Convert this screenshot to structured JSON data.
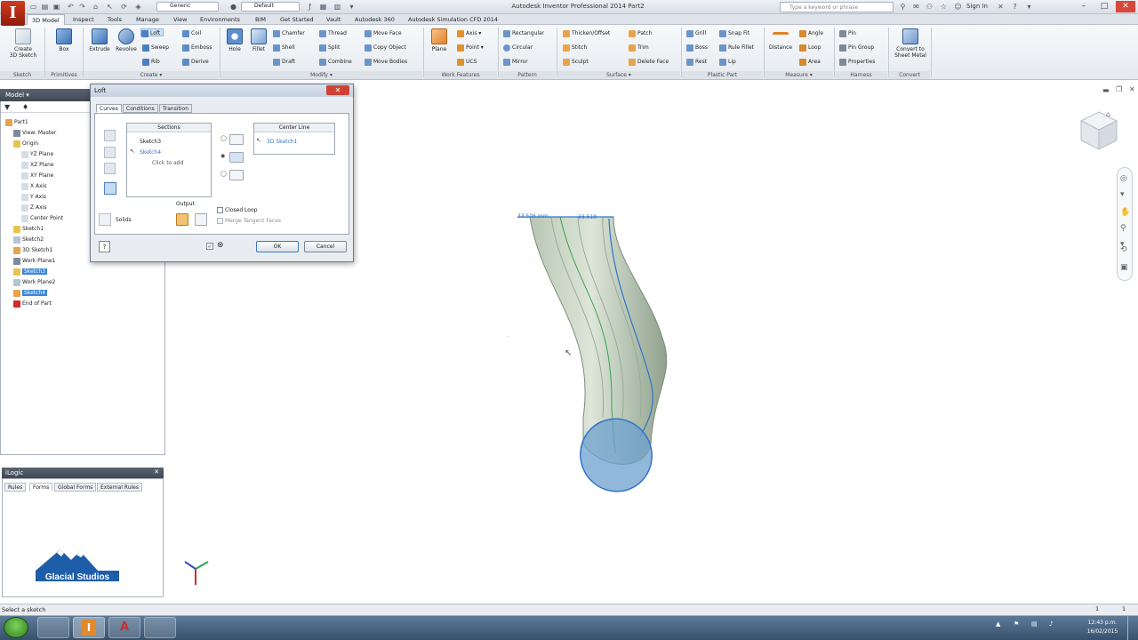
{
  "window": {
    "title": "Autodesk Inventor Professional 2014    Part2",
    "app_logo": "I",
    "qat_appearance": "Generic",
    "qat_style": "Default",
    "search_placeholder": "Type a keyword or phrase",
    "sign_in": "Sign In"
  },
  "ribbon_tabs": [
    "3D Model",
    "Inspect",
    "Tools",
    "Manage",
    "View",
    "Environments",
    "BIM",
    "Get Started",
    "Vault",
    "Autodesk 360",
    "Autodesk Simulation CFD 2014"
  ],
  "ribbon": {
    "sketch": {
      "label": "Sketch",
      "create_3d": "Create\n3D Sketch"
    },
    "primitives": {
      "label": "Primitives",
      "box": "Box"
    },
    "create": {
      "label": "Create ▾",
      "extrude": "Extrude",
      "revolve": "Revolve",
      "loft": "Loft",
      "sweep": "Sweep",
      "rib": "Rib",
      "coil": "Coil",
      "emboss": "Emboss",
      "derive": "Derive"
    },
    "modify": {
      "label": "Modify ▾",
      "hole": "Hole",
      "fillet": "Fillet",
      "chamfer": "Chamfer",
      "shell": "Shell",
      "draft": "Draft",
      "thread": "Thread",
      "split": "Split",
      "combine": "Combine",
      "move_face": "Move Face",
      "copy_object": "Copy Object",
      "move_bodies": "Move Bodies"
    },
    "work_features": {
      "label": "Work Features",
      "plane": "Plane",
      "axis": "Axis ▾",
      "point": "Point ▾",
      "ucs": "UCS"
    },
    "pattern": {
      "label": "Pattern",
      "rectangular": "Rectangular",
      "circular": "Circular",
      "mirror": "Mirror"
    },
    "surface": {
      "label": "Surface ▾",
      "thicken": "Thicken/Offset",
      "stitch": "Stitch",
      "sculpt": "Sculpt",
      "patch": "Patch",
      "trim": "Trim",
      "delete_face": "Delete Face"
    },
    "plastic_part": {
      "label": "Plastic Part",
      "grill": "Grill",
      "boss": "Boss",
      "rest": "Rest",
      "snap_fit": "Snap Fit",
      "rule_fillet": "Rule Fillet",
      "lip": "Lip"
    },
    "measure": {
      "label": "Measure ▾",
      "distance": "Distance",
      "angle": "Angle",
      "loop": "Loop",
      "area": "Area"
    },
    "harness": {
      "label": "Harness",
      "pin": "Pin",
      "pin_group": "Pin Group",
      "properties": "Properties"
    },
    "convert": {
      "label": "Convert",
      "sheet_metal": "Convert to\nSheet Metal"
    }
  },
  "browser": {
    "title": "Model ▾",
    "items": [
      {
        "label": "Part1",
        "indent": 0
      },
      {
        "label": "View: Master",
        "indent": 1
      },
      {
        "label": "Origin",
        "indent": 1
      },
      {
        "label": "YZ Plane",
        "indent": 2
      },
      {
        "label": "XZ Plane",
        "indent": 2
      },
      {
        "label": "XY Plane",
        "indent": 2
      },
      {
        "label": "X Axis",
        "indent": 2
      },
      {
        "label": "Y Axis",
        "indent": 2
      },
      {
        "label": "Z Axis",
        "indent": 2
      },
      {
        "label": "Center Point",
        "indent": 2
      },
      {
        "label": "Sketch1",
        "indent": 1
      },
      {
        "label": "Sketch2",
        "indent": 1
      },
      {
        "label": "3D Sketch1",
        "indent": 1
      },
      {
        "label": "Work Plane1",
        "indent": 1
      },
      {
        "label": "Sketch3",
        "indent": 1,
        "selected": true
      },
      {
        "label": "Work Plane2",
        "indent": 1
      },
      {
        "label": "Sketch4",
        "indent": 1,
        "selected": true
      },
      {
        "label": "End of Part",
        "indent": 1
      }
    ]
  },
  "ilogic": {
    "title": "iLogic",
    "tabs": [
      "Rules",
      "Forms",
      "Global Forms",
      "External Rules"
    ],
    "logo_text": "Glacial Studios"
  },
  "dialog": {
    "title": "Loft",
    "tabs": [
      "Curves",
      "Conditions",
      "Transition"
    ],
    "sections_header": "Sections",
    "sections": [
      "Sketch3",
      "Sketch4"
    ],
    "click_to_add": "Click to add",
    "rails_header": "Center Line",
    "rail_item": "3D Sketch1",
    "output_label": "Output",
    "solids_label": "Solids",
    "closed_loop": "Closed Loop",
    "merge_tangent": "Merge Tangent Faces",
    "ok": "OK",
    "cancel": "Cancel"
  },
  "viewport": {
    "dim_label": "33.506 mm",
    "dim_label2": "33.518"
  },
  "status": {
    "text": "Select a sketch",
    "right_a": "1",
    "right_b": "1"
  },
  "taskbar": {
    "time": "12:43 p.m.",
    "date": "16/02/2015"
  }
}
